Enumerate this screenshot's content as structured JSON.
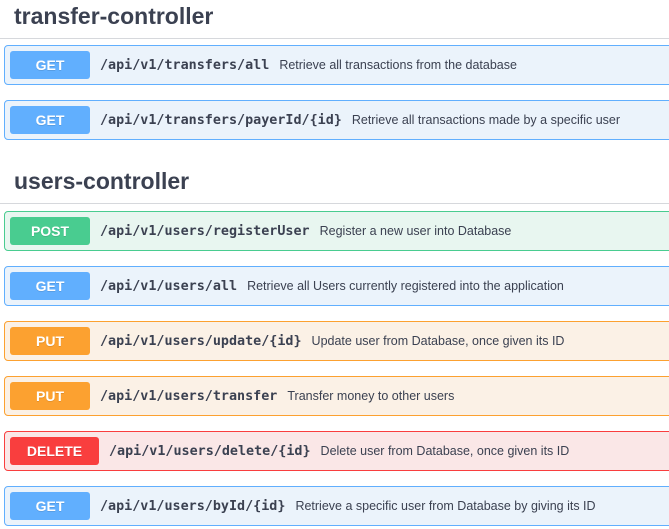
{
  "sections": [
    {
      "title": "transfer-controller",
      "operations": [
        {
          "method": "GET",
          "path": "/api/v1/transfers/all",
          "summary": "Retrieve all transactions from the database"
        },
        {
          "method": "GET",
          "path": "/api/v1/transfers/payerId/{id}",
          "summary": "Retrieve all transactions made by a specific user"
        }
      ]
    },
    {
      "title": "users-controller",
      "operations": [
        {
          "method": "POST",
          "path": "/api/v1/users/registerUser",
          "summary": "Register a new user into Database"
        },
        {
          "method": "GET",
          "path": "/api/v1/users/all",
          "summary": "Retrieve all Users currently registered into the application"
        },
        {
          "method": "PUT",
          "path": "/api/v1/users/update/{id}",
          "summary": "Update user from Database, once given its ID"
        },
        {
          "method": "PUT",
          "path": "/api/v1/users/transfer",
          "summary": "Transfer money to other users"
        },
        {
          "method": "DELETE",
          "path": "/api/v1/users/delete/{id}",
          "summary": "Delete user from Database, once given its ID"
        },
        {
          "method": "GET",
          "path": "/api/v1/users/byId/{id}",
          "summary": "Retrieve a specific user from Database by giving its ID"
        }
      ]
    }
  ],
  "colors": {
    "get": "#61affe",
    "post": "#49cc90",
    "put": "#fca130",
    "delete": "#f93e3e",
    "text": "#3b4151"
  }
}
